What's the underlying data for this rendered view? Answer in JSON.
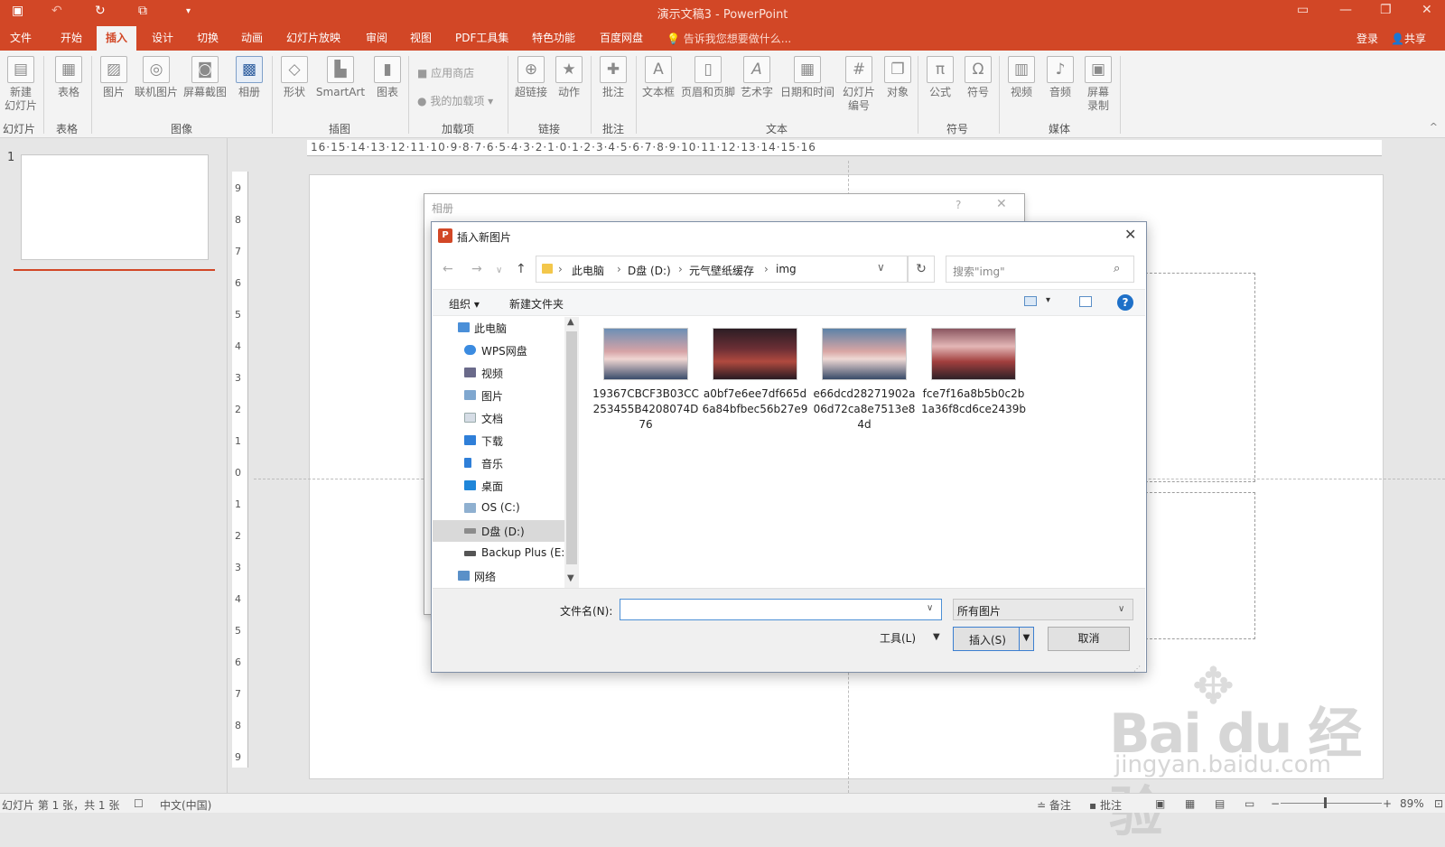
{
  "app": {
    "title": "演示文稿3 - PowerPoint",
    "quick_access": [
      "save-icon",
      "undo-icon",
      "redo-icon",
      "present-icon"
    ]
  },
  "ribbon_tabs": [
    "文件",
    "开始",
    "插入",
    "设计",
    "切换",
    "动画",
    "幻灯片放映",
    "审阅",
    "视图",
    "PDF工具集",
    "特色功能",
    "百度网盘"
  ],
  "active_tab": "插入",
  "tell_me": "告诉我您想要做什么...",
  "login": "登录",
  "share": "共享",
  "ribbon": {
    "buttons": {
      "new_slide": "新建\n幻灯片",
      "table": "表格",
      "picture": "图片",
      "online_picture": "联机图片",
      "screenshot": "屏幕截图",
      "album": "相册",
      "shapes": "形状",
      "smartart": "SmartArt",
      "chart": "图表",
      "app_store": "应用商店",
      "my_addins": "我的加载项",
      "hyperlink": "超链接",
      "action": "动作",
      "comment": "批注",
      "textbox": "文本框",
      "header_footer": "页眉和页脚",
      "wordart": "艺术字",
      "date_time": "日期和时间",
      "slide_number": "幻灯片\n编号",
      "object": "对象",
      "equation": "公式",
      "symbol": "符号",
      "video": "视频",
      "audio": "音频",
      "screen_record": "屏幕\n录制"
    },
    "groups": [
      "幻灯片",
      "表格",
      "图像",
      "插图",
      "加载项",
      "链接",
      "批注",
      "文本",
      "符号",
      "媒体"
    ]
  },
  "thumbnail": {
    "number": "1"
  },
  "ruler": {
    "horizontal": "16·15·14·13·12·11·10·9·8·7·6·5·4·3·2·1·0·1·2·3·4·5·6·7·8·9·10·11·12·13·14·15·16",
    "vertical": [
      "9",
      "8",
      "7",
      "6",
      "5",
      "4",
      "3",
      "2",
      "1",
      "0",
      "1",
      "2",
      "3",
      "4",
      "5",
      "6",
      "7",
      "8",
      "9"
    ]
  },
  "album_dialog": {
    "title": "相册",
    "help": "?"
  },
  "file_dialog": {
    "title": "插入新图片",
    "path": [
      "此电脑",
      "D盘 (D:)",
      "元气壁纸缓存",
      "img"
    ],
    "search_placeholder": "搜索\"img\"",
    "organize": "组织 ▾",
    "new_folder": "新建文件夹",
    "tree": [
      {
        "label": "此电脑",
        "icon": "computer-icon",
        "indent": false
      },
      {
        "label": "WPS网盘",
        "icon": "cloud-icon",
        "indent": true
      },
      {
        "label": "视频",
        "icon": "video-folder-icon",
        "indent": true
      },
      {
        "label": "图片",
        "icon": "pictures-folder-icon",
        "indent": true
      },
      {
        "label": "文档",
        "icon": "documents-folder-icon",
        "indent": true
      },
      {
        "label": "下载",
        "icon": "download-folder-icon",
        "indent": true
      },
      {
        "label": "音乐",
        "icon": "music-folder-icon",
        "indent": true
      },
      {
        "label": "桌面",
        "icon": "desktop-folder-icon",
        "indent": true
      },
      {
        "label": "OS (C:)",
        "icon": "drive-icon",
        "indent": true
      },
      {
        "label": "D盘 (D:)",
        "icon": "drive-icon",
        "indent": true,
        "selected": true
      },
      {
        "label": "Backup Plus (E:)",
        "icon": "external-drive-icon",
        "indent": true
      },
      {
        "label": "网络",
        "icon": "network-icon",
        "indent": false
      }
    ],
    "files": [
      "19367CBCF3B03CC253455B4208074D76",
      "a0bf7e6ee7df665d6a84bfbec56b27e9",
      "e66dcd28271902a06d72ca8e7513e84d",
      "fce7f16a8b5b0c2b1a36f8cd6ce2439b"
    ],
    "filename_label": "文件名(N):",
    "filename_value": "",
    "filetype": "所有图片",
    "tools": "工具(L)",
    "insert": "插入(S)",
    "cancel": "取消"
  },
  "status": {
    "slide_info": "幻灯片 第 1 张，共 1 张",
    "language": "中文(中国)",
    "notes": "备注",
    "comments": "批注",
    "zoom": "89%"
  },
  "watermark": {
    "brand": "Bai du 经验",
    "url": "jingyan.baidu.com"
  },
  "colors": {
    "accent": "#d24726",
    "selection": "#d9d9d9",
    "button_focus": "#3c7fd0"
  }
}
